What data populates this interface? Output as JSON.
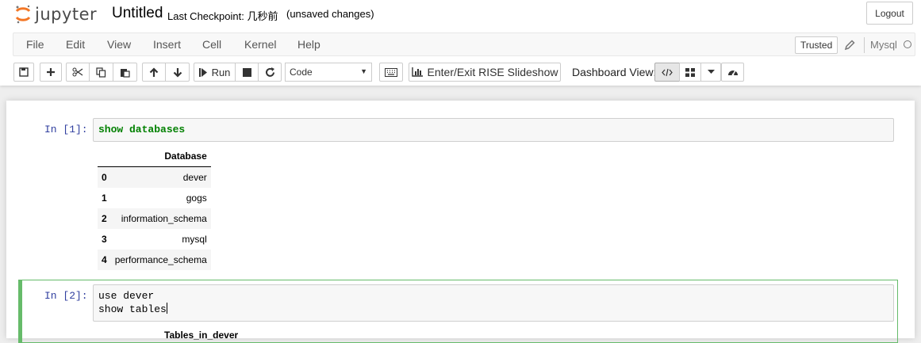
{
  "header": {
    "logo_text": "jupyter",
    "notebook_name": "Untitled",
    "checkpoint": "Last Checkpoint: 几秒前",
    "autosave_status": "(unsaved changes)",
    "logout_label": "Logout"
  },
  "menu": {
    "items": [
      "File",
      "Edit",
      "View",
      "Insert",
      "Cell",
      "Kernel",
      "Help"
    ],
    "trusted_label": "Trusted",
    "kernel_name": "Mysql"
  },
  "toolbar": {
    "run_label": "Run",
    "cell_type": "Code",
    "rise_label": "Enter/Exit RISE Slideshow",
    "dashboard_label": "Dashboard View:"
  },
  "cells": [
    {
      "prompt": "In  [1]:",
      "source_line1": "show databases",
      "output": {
        "column": "Database",
        "rows": [
          {
            "index": "0",
            "value": "dever"
          },
          {
            "index": "1",
            "value": "gogs"
          },
          {
            "index": "2",
            "value": "information_schema"
          },
          {
            "index": "3",
            "value": "mysql"
          },
          {
            "index": "4",
            "value": "performance_schema"
          }
        ]
      }
    },
    {
      "prompt": "In  [2]:",
      "source_line1": "use dever",
      "source_line2": "show tables",
      "output_partial_header": "Tables_in_dever"
    }
  ]
}
